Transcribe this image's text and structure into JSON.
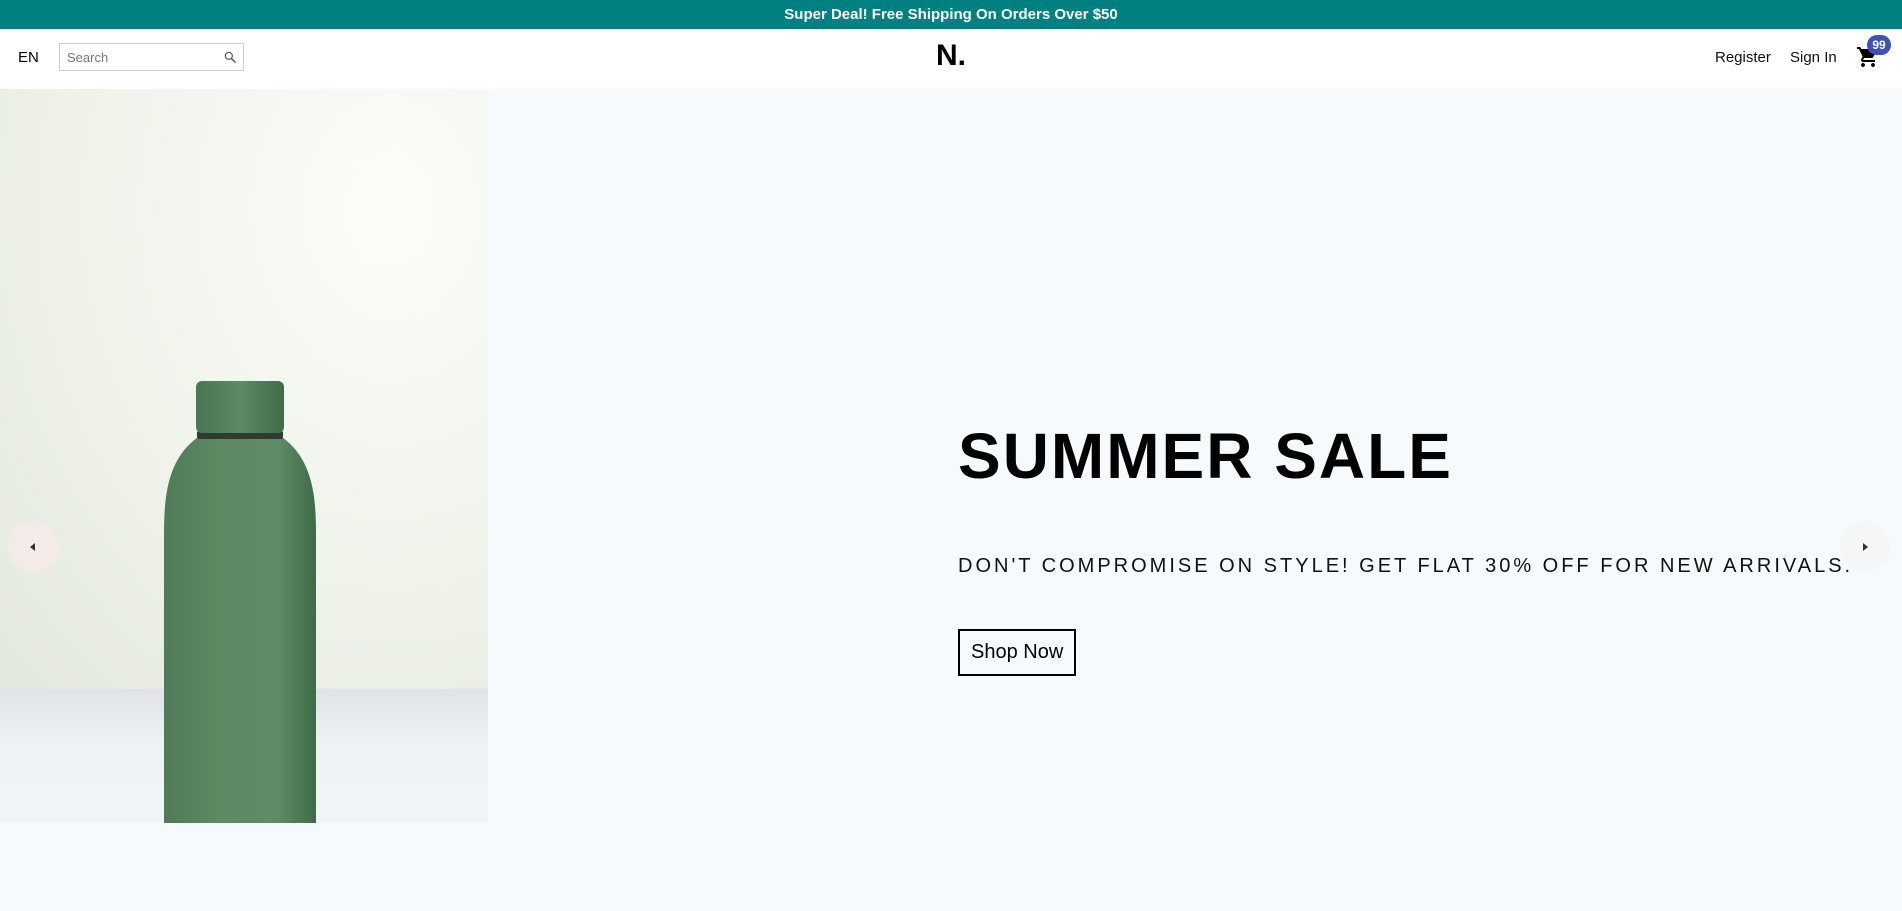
{
  "announcement": {
    "text": "Super Deal! Free Shipping On Orders Over $50",
    "background": "#008080"
  },
  "navbar": {
    "language": "EN",
    "search": {
      "placeholder": "Search",
      "value": "",
      "icon": "search-icon"
    },
    "logo": "N.",
    "links": {
      "register": "Register",
      "sign_in": "Sign In"
    },
    "cart": {
      "icon": "cart-icon",
      "badge_count": "99",
      "badge_color": "#3f51b5"
    }
  },
  "slider": {
    "background": "#f5fafd",
    "slide": {
      "image": "green-water-bottle",
      "title": "SUMMER SALE",
      "description": "DON'T COMPROMISE ON STYLE! GET FLAT 30% OFF FOR NEW ARRIVALS.",
      "button_label": "Shop Now"
    },
    "controls": {
      "left_icon": "arrow-left-icon",
      "right_icon": "arrow-right-icon"
    }
  }
}
